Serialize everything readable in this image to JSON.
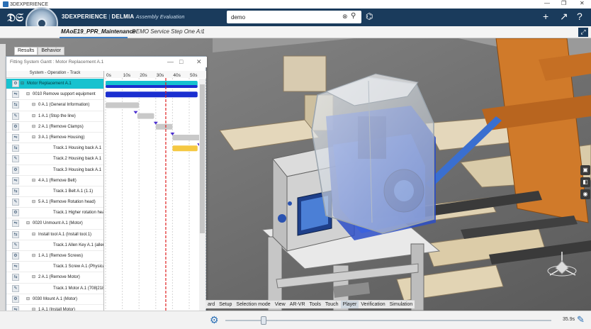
{
  "app": {
    "window_title": "3DEXPERIENCE",
    "brand_main": "3DEXPERIENCE",
    "brand_product": "DELMIA",
    "brand_sub": "Assembly Evaluation",
    "search_value": "demo"
  },
  "tabs": [
    {
      "label": "MAoE19_PPR_Maintenance",
      "active": true
    },
    {
      "label": "DEMO Service Step One A.1",
      "active": false
    }
  ],
  "sidebar": {
    "tabs": [
      {
        "label": "Results",
        "active": true
      },
      {
        "label": "Behavior",
        "active": false
      }
    ]
  },
  "gantt": {
    "title": "Fitting System Gantt : Motor Replacement A.1",
    "column_header": "System - Operation - Track",
    "time_ticks": [
      "0s",
      "10s",
      "20s",
      "30s",
      "40s",
      "50s",
      "6"
    ],
    "rows": [
      {
        "label": "Motor Replacement A.1",
        "level": 0,
        "selected": true
      },
      {
        "label": "0010 Remove support equipment",
        "level": 1
      },
      {
        "label": "0 A.1 (General Information)",
        "level": 2
      },
      {
        "label": "1 A.1 (Stop the line)",
        "level": 2
      },
      {
        "label": "2 A.1 (Remove Clamps)",
        "level": 2
      },
      {
        "label": "3 A.1 (Remove Housing)",
        "level": 2
      },
      {
        "label": "Track.1  Housing back A.1",
        "level": 3
      },
      {
        "label": "Track.2  Housing back A.1",
        "level": 3
      },
      {
        "label": "Track.3  Housing back A.1",
        "level": 3
      },
      {
        "label": "4 A.1 (Remove Belt)",
        "level": 2
      },
      {
        "label": "Track.1  Belt A.1 (1.1)",
        "level": 3
      },
      {
        "label": "5 A.1 (Remove Rotation head)",
        "level": 2
      },
      {
        "label": "Track.1  Higher rotation head",
        "level": 3
      },
      {
        "label": "0020 Unmount A.1 (Motor)",
        "level": 1
      },
      {
        "label": "Install tool A.1 (Install tool.1)",
        "level": 2
      },
      {
        "label": "Track.1  Allen Key A.1 (allen",
        "level": 3
      },
      {
        "label": "1 A.1 (Remove Screws)",
        "level": 2
      },
      {
        "label": "Track.1  Screw A.1 (Physical",
        "level": 3
      },
      {
        "label": "2 A.1 (Remove Motor)",
        "level": 2
      },
      {
        "label": "Track.1  Motor A.1 (708|218",
        "level": 3
      },
      {
        "label": "0030 Mount A.1 (Motor)",
        "level": 1
      },
      {
        "label": "1 A.1 (Install Motor)",
        "level": 2
      }
    ],
    "bars": [
      {
        "row": 0,
        "start": 0,
        "end": 55,
        "color": "#17c2cf"
      },
      {
        "row": 0,
        "start": 0,
        "end": 55,
        "color": "#1b2fd0",
        "thin": true
      },
      {
        "row": 1,
        "start": 0,
        "end": 55,
        "color": "#1b2fd0"
      },
      {
        "row": 2,
        "start": 0,
        "end": 20,
        "color": "#c9c9c9"
      },
      {
        "row": 3,
        "start": 19,
        "end": 29,
        "color": "#c9c9c9"
      },
      {
        "row": 4,
        "start": 30,
        "end": 40,
        "color": "#c9c9c9"
      },
      {
        "row": 5,
        "start": 40,
        "end": 58,
        "color": "#c9c9c9"
      },
      {
        "row": 6,
        "start": 40,
        "end": 55,
        "color": "#f5c842"
      }
    ],
    "milestones": [
      18,
      30,
      40,
      56
    ],
    "current_time": 36
  },
  "toolbar": [
    "ard",
    "Setup",
    "Selection mode",
    "View",
    "AR-VR",
    "Tools",
    "Touch",
    "Player",
    "Verification",
    "Simulation"
  ],
  "toolbar_active": "Player",
  "player": {
    "time": "35.9s"
  },
  "colors": {
    "accent": "#2a6fb5",
    "topbar": "#1a3b5c",
    "selected": "#17c2cf"
  }
}
